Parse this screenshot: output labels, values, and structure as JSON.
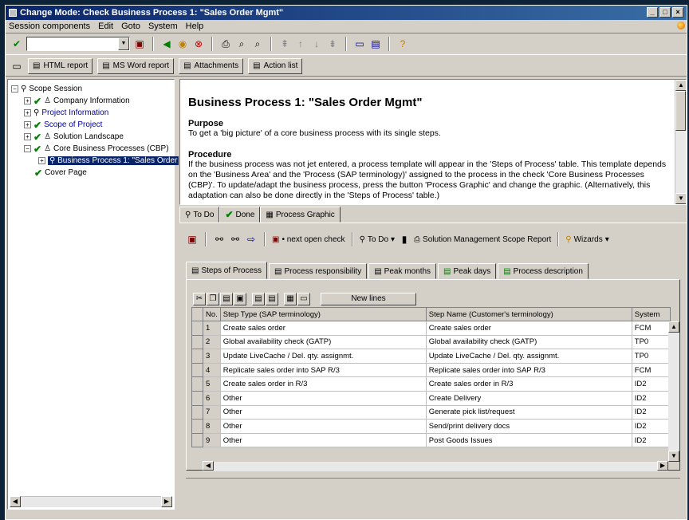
{
  "window": {
    "title": "Change Mode: Check Business Process 1: \"Sales Order Mgmt\"",
    "controls": [
      "_",
      "□",
      "×"
    ]
  },
  "menu": [
    "Session components",
    "Edit",
    "Goto",
    "System",
    "Help"
  ],
  "toolbar2": {
    "html_report": "HTML report",
    "word_report": "MS Word report",
    "attachments": "Attachments",
    "action_list": "Action list"
  },
  "tree": {
    "items": [
      {
        "label": "Scope Session",
        "level": 0
      },
      {
        "label": "Company Information",
        "level": 1
      },
      {
        "label": "Project Information",
        "level": 1
      },
      {
        "label": "Scope of Project",
        "level": 1
      },
      {
        "label": "Solution Landscape",
        "level": 1
      },
      {
        "label": "Core Business Processes (CBP)",
        "level": 1
      },
      {
        "label": "Business Process 1: \"Sales Order",
        "level": 2
      },
      {
        "label": "Cover Page",
        "level": 1
      }
    ]
  },
  "description": {
    "title": "Business Process 1: \"Sales Order Mgmt\"",
    "purpose_heading": "Purpose",
    "purpose_text": "To get a 'big picture' of a core business process with its single steps.",
    "procedure_heading": "Procedure",
    "procedure_text": "If the business process was not jet entered, a process template will appear in the 'Steps of Process' table. This template depends on the 'Business Area' and the 'Process (SAP terminology)' assigned to the process in the check 'Core Business Processes (CBP)'. To update/adapt the business process, press the button 'Process Graphic' and change the graphic. (Alternatively, this adaptation can also be done directly in the 'Steps of Process' table.)"
  },
  "status_tabs": [
    "To Do",
    "Done",
    "Process Graphic"
  ],
  "panel_toolbar": {
    "next_open_check": "• next open check",
    "todo": "To Do",
    "scope_report": "Solution Management Scope Report",
    "wizards": "Wizards"
  },
  "inner_tabs": [
    "Steps of Process",
    "Process responsibility",
    "Peak months",
    "Peak days",
    "Process description"
  ],
  "grid": {
    "new_lines": "New lines",
    "columns": [
      "No.",
      "Step Type (SAP terminology)",
      "Step Name (Customer's terminology)",
      "System"
    ],
    "rows": [
      [
        "1",
        "Create sales order",
        "Create sales order",
        "FCM"
      ],
      [
        "2",
        "Global availability check (GATP)",
        "Global availability check (GATP)",
        "TP0"
      ],
      [
        "3",
        "Update LiveCache / Del. qty. assignmt.",
        "Update LiveCache / Del. qty. assignmt.",
        "TP0"
      ],
      [
        "4",
        "Replicate sales order into SAP R/3",
        "Replicate sales order into SAP R/3",
        "FCM"
      ],
      [
        "5",
        "Create sales order in R/3",
        "Create sales order in R/3",
        "ID2"
      ],
      [
        "6",
        "Other",
        "Create Delivery",
        "ID2"
      ],
      [
        "7",
        "Other",
        "Generate pick list/request",
        "ID2"
      ],
      [
        "8",
        "Other",
        "Send/print delivery docs",
        "ID2"
      ],
      [
        "9",
        "Other",
        "Post Goods Issues",
        "ID2"
      ]
    ]
  }
}
